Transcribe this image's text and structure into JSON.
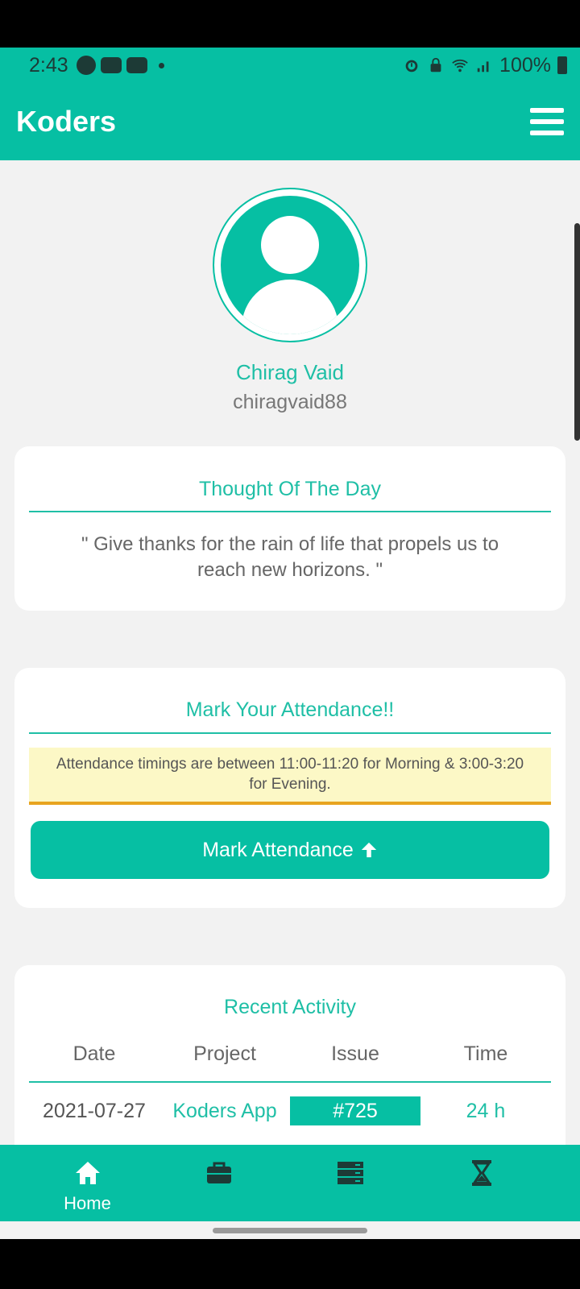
{
  "status_bar": {
    "time": "2:43",
    "battery": "100%"
  },
  "app_bar": {
    "title": "Koders"
  },
  "profile": {
    "name": "Chirag Vaid",
    "username": "chiragvaid88"
  },
  "thought": {
    "title": "Thought Of The Day",
    "quote": "\" Give thanks for the rain of life that propels us to reach new horizons. \""
  },
  "attendance": {
    "title": "Mark Your Attendance!!",
    "notice": "Attendance timings are between 11:00-11:20 for Morning & 3:00-3:20 for Evening.",
    "button_label": "Mark Attendance"
  },
  "activity": {
    "title": "Recent Activity",
    "columns": [
      "Date",
      "Project",
      "Issue",
      "Time"
    ],
    "rows": [
      {
        "date": "2021-07-27",
        "project": "Koders App",
        "issue": "#725",
        "time": "24 h"
      }
    ]
  },
  "bottom_nav": {
    "items": [
      {
        "label": "Home",
        "icon": "home-icon"
      },
      {
        "label": "",
        "icon": "briefcase-icon"
      },
      {
        "label": "",
        "icon": "server-icon"
      },
      {
        "label": "",
        "icon": "hourglass-icon"
      }
    ]
  },
  "colors": {
    "primary": "#06bfa3",
    "notice_bg": "#fcf8c6",
    "notice_border": "#e8a41f"
  }
}
